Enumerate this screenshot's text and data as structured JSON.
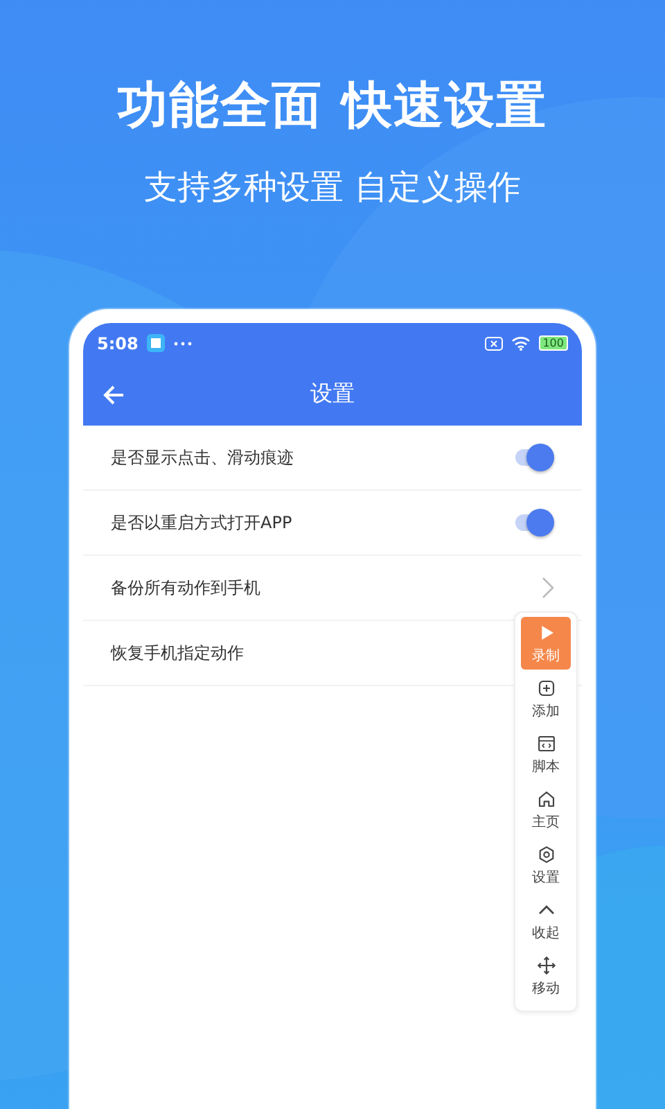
{
  "headline": "功能全面 快速设置",
  "subheadline": "支持多种设置 自定义操作",
  "status_bar": {
    "time": "5:08",
    "battery": "100"
  },
  "app_bar": {
    "title": "设置"
  },
  "settings": [
    {
      "label": "是否显示点击、滑动痕迹",
      "kind": "toggle",
      "on": true
    },
    {
      "label": "是否以重启方式打开APP",
      "kind": "toggle",
      "on": true
    },
    {
      "label": "备份所有动作到手机",
      "kind": "link"
    },
    {
      "label": "恢复手机指定动作",
      "kind": "text"
    }
  ],
  "floating_toolbar": [
    {
      "label": "录制",
      "selected": true
    },
    {
      "label": "添加",
      "selected": false
    },
    {
      "label": "脚本",
      "selected": false
    },
    {
      "label": "主页",
      "selected": false
    },
    {
      "label": "设置",
      "selected": false
    },
    {
      "label": "收起",
      "selected": false
    },
    {
      "label": "移动",
      "selected": false
    }
  ]
}
